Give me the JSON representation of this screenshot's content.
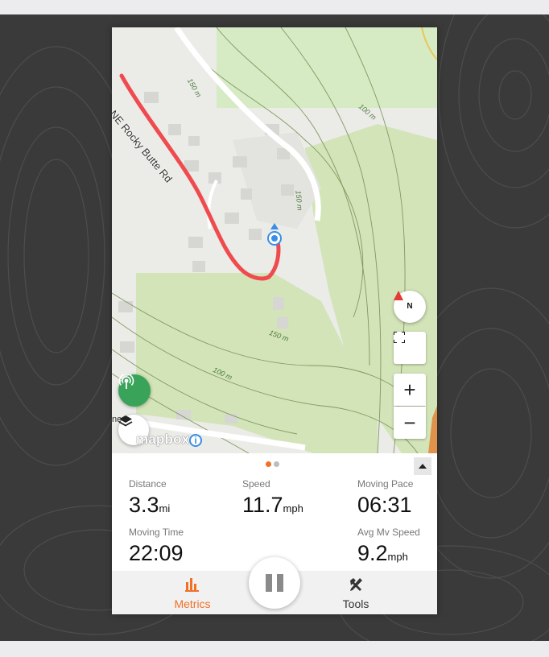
{
  "map": {
    "road_name": "NE Rocky Butte Rd",
    "contour_labels": [
      "150 m",
      "100 m",
      "150 m",
      "150 m",
      "100 m"
    ],
    "attribution_logo": "mapbox",
    "attribution_info": "i",
    "edge_text": "ner",
    "compass_letter": "N",
    "zoom_in_label": "+",
    "zoom_out_label": "−",
    "colors": {
      "track": "#ef4b4f",
      "park": "#cfe6b9",
      "accent": "#3aa35a"
    }
  },
  "pager": {
    "dot_colors": [
      "#f27026",
      "#bdbdbd"
    ]
  },
  "metrics": {
    "distance": {
      "label": "Distance",
      "value": "3.3",
      "unit": "mi"
    },
    "speed": {
      "label": "Speed",
      "value": "11.7",
      "unit": "mph"
    },
    "moving_pace": {
      "label": "Moving Pace",
      "value": "06:31",
      "unit": ""
    },
    "moving_time": {
      "label": "Moving Time",
      "value": "22:09",
      "unit": ""
    },
    "avg_mv_speed": {
      "label": "Avg Mv Speed",
      "value": "9.2",
      "unit": "mph"
    }
  },
  "tabs": {
    "metrics": {
      "label": "Metrics",
      "icon": "bar-chart-icon",
      "color": "#f27026"
    },
    "tools": {
      "label": "Tools",
      "icon": "tools-icon",
      "color": "#333333"
    }
  }
}
